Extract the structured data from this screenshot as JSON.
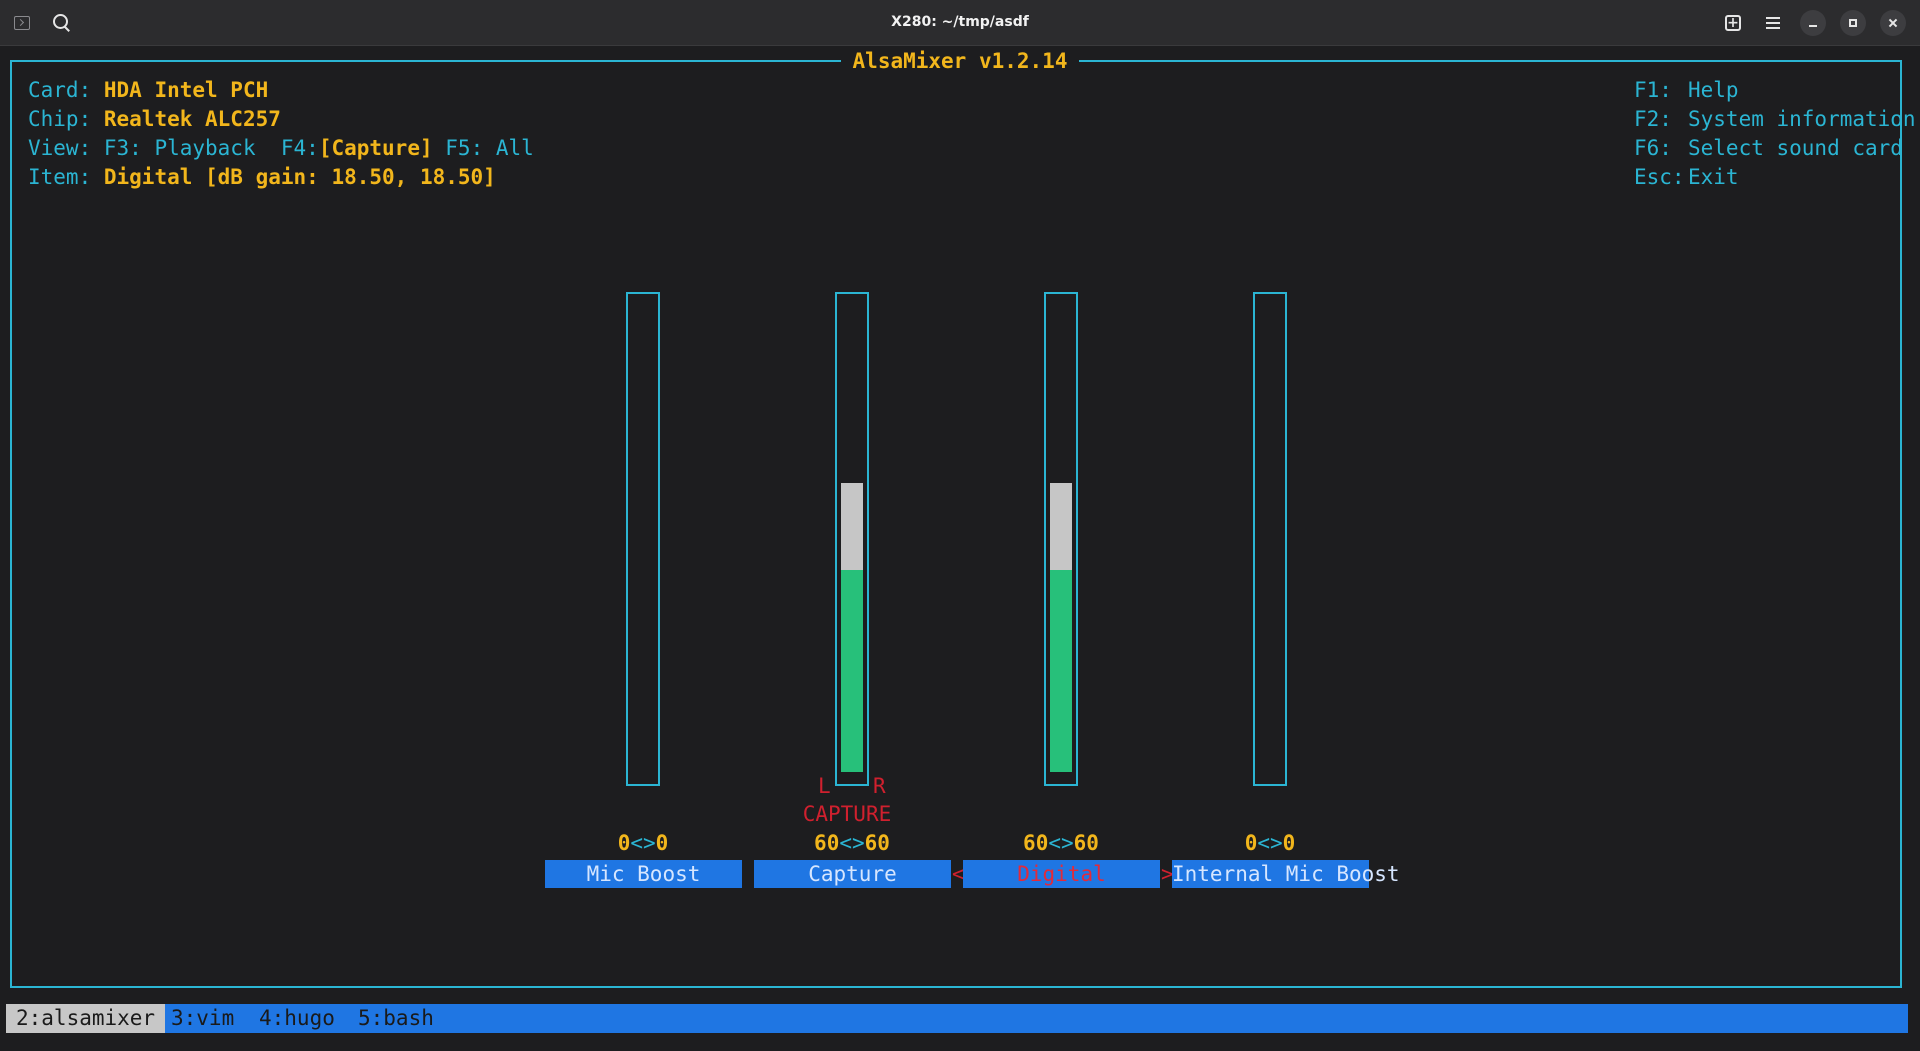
{
  "window": {
    "title": "X280: ~/tmp/asdf",
    "icons": [
      "terminal-icon",
      "search-icon",
      "new-tab-icon",
      "menu-icon",
      "minimize-icon",
      "maximize-icon",
      "close-icon"
    ]
  },
  "mixer": {
    "title": "AlsaMixer v1.2.14",
    "card_label": "Card:",
    "card_value": "HDA Intel PCH",
    "chip_label": "Chip:",
    "chip_value": "Realtek ALC257",
    "view_label": "View:",
    "view_f3": "F3: Playback",
    "view_f4_key": "F4:",
    "view_f4_value": "[Capture]",
    "view_f5": "F5: All",
    "item_label": "Item:",
    "item_value": "Digital [dB gain: 18.50, 18.50]",
    "help": [
      {
        "key": "F1:",
        "action": "Help"
      },
      {
        "key": "F2:",
        "action": "System information"
      },
      {
        "key": "F6:",
        "action": "Select sound card"
      },
      {
        "key": "Esc:",
        "action": "Exit"
      }
    ],
    "channels": [
      {
        "name": "Mic Boost",
        "left": "0",
        "right": "0",
        "sep": "<>",
        "level": 0
      },
      {
        "name": "Capture",
        "left": "60",
        "right": "60",
        "sep": "<>",
        "level": 0.61,
        "l_mark": "L",
        "r_mark": "R",
        "switch_label": "CAPTURE"
      },
      {
        "name": "Digital",
        "left": "60",
        "right": "60",
        "sep": "<>",
        "level": 0.61,
        "selected": true,
        "sel_left": "<",
        "sel_right": ">"
      },
      {
        "name": "Internal Mic Boost",
        "left": "0",
        "right": "0",
        "sep": "<>",
        "level": 0
      }
    ]
  },
  "tmux": {
    "windows": [
      "2:alsamixer",
      "3:vim",
      "4:hugo",
      "5:bash"
    ],
    "current": 0
  },
  "colors": {
    "border": "#2bb5d3",
    "value": "#f2b61c",
    "fill": "#27c07a",
    "selected": "#e32a3a",
    "status_bar": "#1f76e3"
  }
}
